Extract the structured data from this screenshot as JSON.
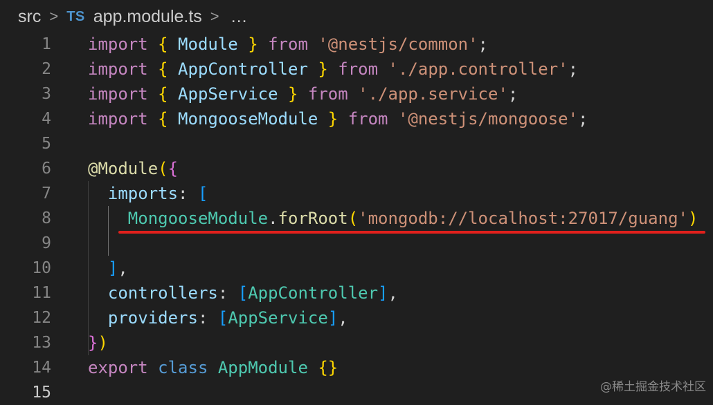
{
  "breadcrumb": {
    "folder": "src",
    "separator": ">",
    "file_icon": "TS",
    "file_name": "app.module.ts",
    "trailing": "…"
  },
  "lines": [
    {
      "num": "1",
      "tokens": [
        {
          "t": "import",
          "c": "kw"
        },
        {
          "t": " ",
          "c": "pn"
        },
        {
          "t": "{",
          "c": "b1"
        },
        {
          "t": " Module ",
          "c": "id"
        },
        {
          "t": "}",
          "c": "b1"
        },
        {
          "t": " ",
          "c": "pn"
        },
        {
          "t": "from",
          "c": "kw"
        },
        {
          "t": " ",
          "c": "pn"
        },
        {
          "t": "'@nestjs/common'",
          "c": "str"
        },
        {
          "t": ";",
          "c": "pn"
        }
      ]
    },
    {
      "num": "2",
      "tokens": [
        {
          "t": "import",
          "c": "kw"
        },
        {
          "t": " ",
          "c": "pn"
        },
        {
          "t": "{",
          "c": "b1"
        },
        {
          "t": " AppController ",
          "c": "id"
        },
        {
          "t": "}",
          "c": "b1"
        },
        {
          "t": " ",
          "c": "pn"
        },
        {
          "t": "from",
          "c": "kw"
        },
        {
          "t": " ",
          "c": "pn"
        },
        {
          "t": "'./app.controller'",
          "c": "str"
        },
        {
          "t": ";",
          "c": "pn"
        }
      ]
    },
    {
      "num": "3",
      "tokens": [
        {
          "t": "import",
          "c": "kw"
        },
        {
          "t": " ",
          "c": "pn"
        },
        {
          "t": "{",
          "c": "b1"
        },
        {
          "t": " AppService ",
          "c": "id"
        },
        {
          "t": "}",
          "c": "b1"
        },
        {
          "t": " ",
          "c": "pn"
        },
        {
          "t": "from",
          "c": "kw"
        },
        {
          "t": " ",
          "c": "pn"
        },
        {
          "t": "'./app.service'",
          "c": "str"
        },
        {
          "t": ";",
          "c": "pn"
        }
      ]
    },
    {
      "num": "4",
      "tokens": [
        {
          "t": "import",
          "c": "kw"
        },
        {
          "t": " ",
          "c": "pn"
        },
        {
          "t": "{",
          "c": "b1"
        },
        {
          "t": " MongooseModule ",
          "c": "id"
        },
        {
          "t": "}",
          "c": "b1"
        },
        {
          "t": " ",
          "c": "pn"
        },
        {
          "t": "from",
          "c": "kw"
        },
        {
          "t": " ",
          "c": "pn"
        },
        {
          "t": "'@nestjs/mongoose'",
          "c": "str"
        },
        {
          "t": ";",
          "c": "pn"
        }
      ]
    },
    {
      "num": "5",
      "tokens": []
    },
    {
      "num": "6",
      "tokens": [
        {
          "t": "@Module",
          "c": "fn"
        },
        {
          "t": "(",
          "c": "b1"
        },
        {
          "t": "{",
          "c": "b2"
        }
      ]
    },
    {
      "num": "7",
      "tokens": [
        {
          "t": "  imports",
          "c": "id"
        },
        {
          "t": ": ",
          "c": "pn"
        },
        {
          "t": "[",
          "c": "b3"
        }
      ]
    },
    {
      "num": "8",
      "tokens": [
        {
          "t": "    ",
          "c": "pn"
        },
        {
          "t": "MongooseModule",
          "c": "cls"
        },
        {
          "t": ".",
          "c": "pn"
        },
        {
          "t": "forRoot",
          "c": "fn"
        },
        {
          "t": "(",
          "c": "b1"
        },
        {
          "t": "'mongodb://localhost:27017/guang'",
          "c": "str"
        },
        {
          "t": ")",
          "c": "b1"
        }
      ]
    },
    {
      "num": "9",
      "tokens": []
    },
    {
      "num": "10",
      "tokens": [
        {
          "t": "  ",
          "c": "pn"
        },
        {
          "t": "]",
          "c": "b3"
        },
        {
          "t": ",",
          "c": "pn"
        }
      ]
    },
    {
      "num": "11",
      "tokens": [
        {
          "t": "  controllers",
          "c": "id"
        },
        {
          "t": ": ",
          "c": "pn"
        },
        {
          "t": "[",
          "c": "b3"
        },
        {
          "t": "AppController",
          "c": "cls"
        },
        {
          "t": "]",
          "c": "b3"
        },
        {
          "t": ",",
          "c": "pn"
        }
      ]
    },
    {
      "num": "12",
      "tokens": [
        {
          "t": "  providers",
          "c": "id"
        },
        {
          "t": ": ",
          "c": "pn"
        },
        {
          "t": "[",
          "c": "b3"
        },
        {
          "t": "AppService",
          "c": "cls"
        },
        {
          "t": "]",
          "c": "b3"
        },
        {
          "t": ",",
          "c": "pn"
        }
      ]
    },
    {
      "num": "13",
      "tokens": [
        {
          "t": "}",
          "c": "b2"
        },
        {
          "t": ")",
          "c": "b1"
        }
      ]
    },
    {
      "num": "14",
      "tokens": [
        {
          "t": "export",
          "c": "kw"
        },
        {
          "t": " ",
          "c": "pn"
        },
        {
          "t": "class",
          "c": "kw2"
        },
        {
          "t": " ",
          "c": "pn"
        },
        {
          "t": "AppModule",
          "c": "cls"
        },
        {
          "t": " ",
          "c": "pn"
        },
        {
          "t": "{}",
          "c": "b1"
        }
      ]
    },
    {
      "num": "15",
      "tokens": []
    }
  ],
  "active_line": "15",
  "highlighted_line": "8",
  "watermark": "@稀土掘金技术社区",
  "colors": {
    "background": "#1f1f1f",
    "underline": "#e0201c"
  }
}
